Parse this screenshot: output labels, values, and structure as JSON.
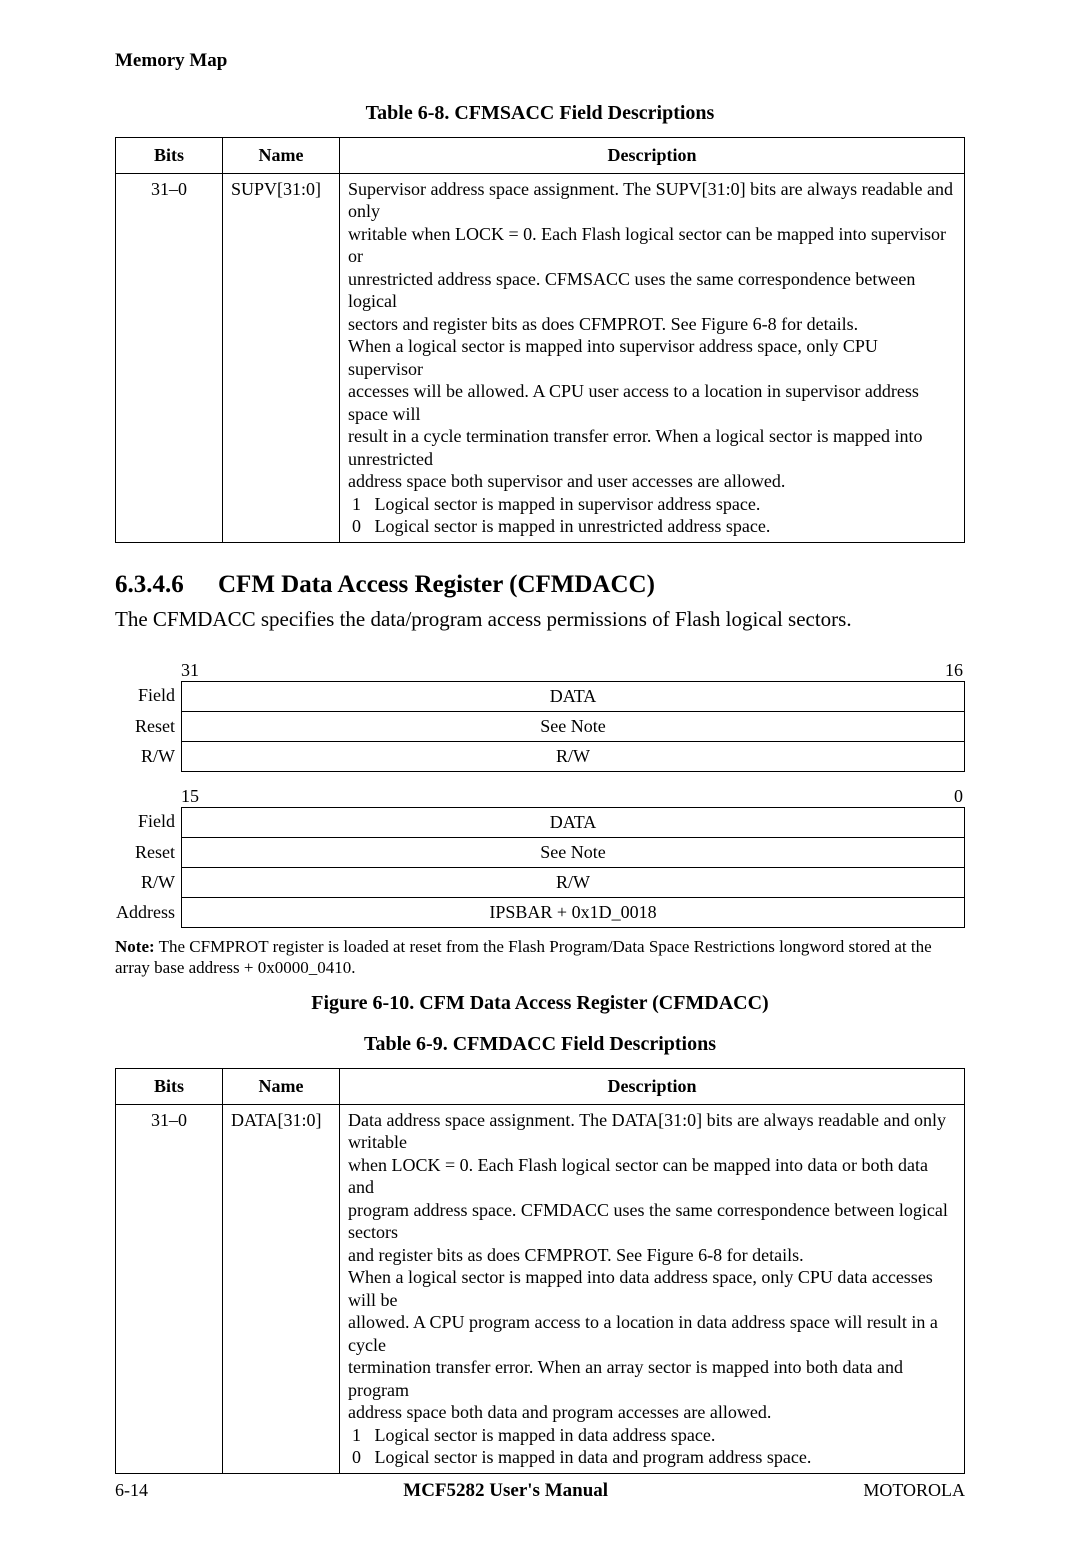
{
  "header": {
    "section": "Memory Map"
  },
  "table8": {
    "caption": "Table 6-8. CFMSACC Field Descriptions",
    "headers": {
      "bits": "Bits",
      "name": "Name",
      "desc": "Description"
    },
    "row": {
      "bits": "31–0",
      "name": "SUPV[31:0]",
      "lines": [
        "Supervisor address space assignment. The SUPV[31:0] bits are always readable and only",
        "writable when LOCK = 0. Each Flash logical sector can be mapped into supervisor or",
        "unrestricted address space. CFMSACC uses the same correspondence between logical",
        "sectors and register bits as does CFMPROT. See Figure 6-8 for details.",
        "When a logical sector is mapped into supervisor address space, only CPU supervisor",
        "accesses will be allowed. A CPU user access to a location in supervisor address space will",
        "result in a cycle termination transfer error. When a logical sector is mapped into unrestricted",
        "address space both supervisor and user accesses are allowed."
      ],
      "enum": [
        {
          "k": "1",
          "v": "Logical sector is mapped in supervisor address space."
        },
        {
          "k": "0",
          "v": "Logical sector is mapped in unrestricted address space."
        }
      ]
    }
  },
  "section": {
    "num": "6.3.4.6",
    "title": "CFM Data Access Register (CFMDACC)",
    "body": "The CFMDACC specifies the data/program access permissions of Flash logical sectors."
  },
  "regfig": {
    "top": {
      "hi": "31",
      "lo": "16",
      "field": "DATA",
      "reset": "See Note",
      "rw": "R/W"
    },
    "bottom": {
      "hi": "15",
      "lo": "0",
      "field": "DATA",
      "reset": "See Note",
      "rw": "R/W",
      "address": "IPSBAR + 0x1D_0018"
    },
    "labels": {
      "field": "Field",
      "reset": "Reset",
      "rw": "R/W",
      "address": "Address"
    },
    "note_label": "Note:",
    "note": "The CFMPROT register is loaded at reset from the Flash Program/Data Space Restrictions longword stored at the array base address + 0x0000_0410.",
    "caption": "Figure 6-10. CFM Data Access Register (CFMDACC)"
  },
  "table9": {
    "caption": "Table 6-9. CFMDACC Field Descriptions",
    "headers": {
      "bits": "Bits",
      "name": "Name",
      "desc": "Description"
    },
    "row": {
      "bits": "31–0",
      "name": "DATA[31:0]",
      "lines": [
        "Data address space assignment. The DATA[31:0] bits are always readable and only writable",
        "when LOCK = 0. Each Flash logical sector can be mapped into data or both data and",
        "program address space. CFMDACC uses the same correspondence between logical sectors",
        "and register bits as does CFMPROT. See Figure 6-8 for details.",
        "When a logical sector is mapped into data address space, only CPU data accesses will be",
        "allowed. A CPU program access to a location in data address space will result in a cycle",
        "termination transfer error. When an array sector is mapped into both data and program",
        "address space both data and program accesses are allowed."
      ],
      "enum": [
        {
          "k": "1",
          "v": "Logical sector is mapped in data address space."
        },
        {
          "k": "0",
          "v": "Logical sector is mapped in data and program address space."
        }
      ]
    }
  },
  "footer": {
    "page": "6-14",
    "manual": "MCF5282 User's Manual",
    "brand": "MOTOROLA"
  }
}
